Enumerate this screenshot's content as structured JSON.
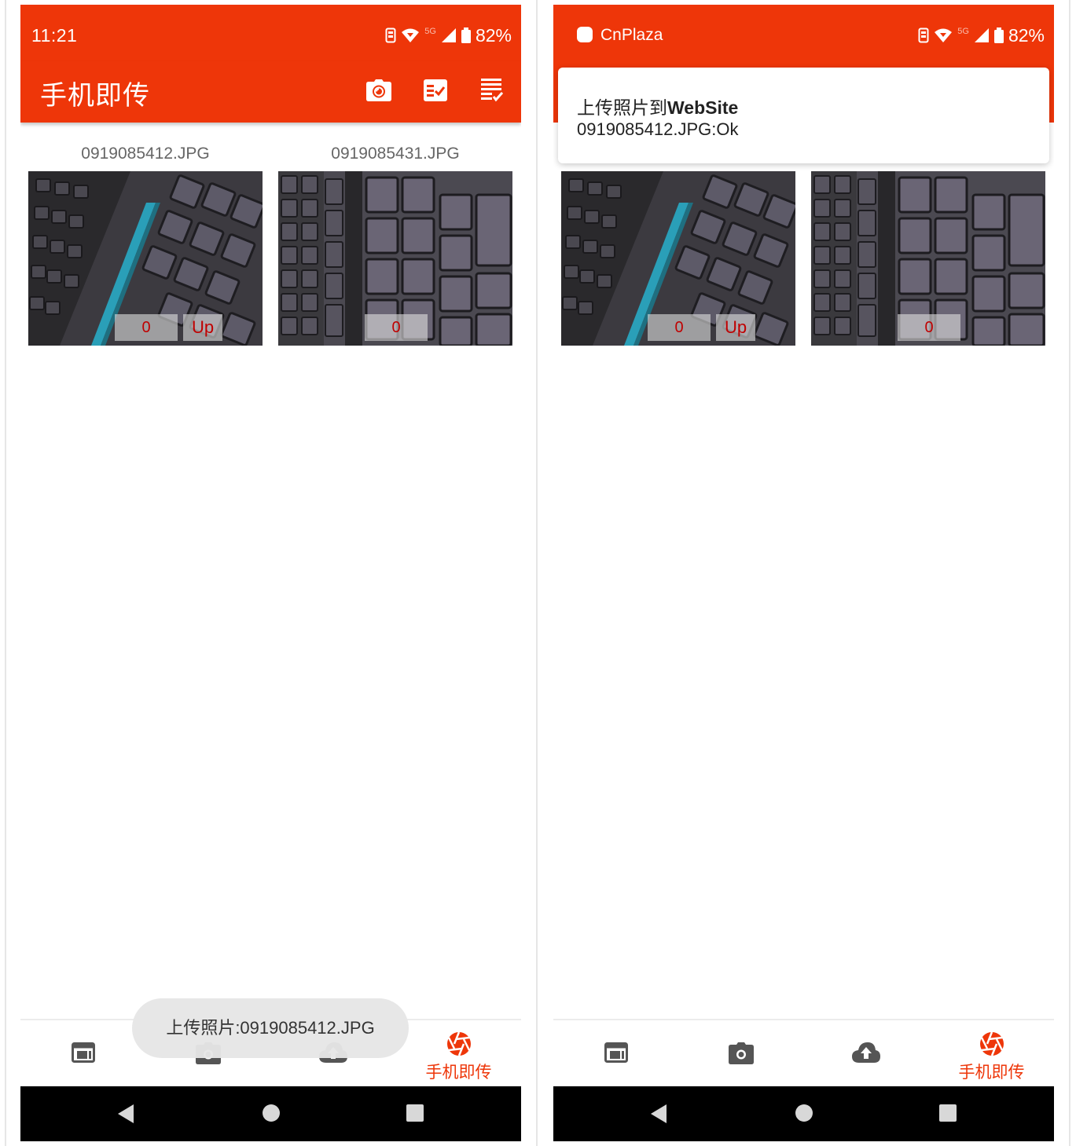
{
  "left_screen": {
    "status_bar": {
      "time": "11:21",
      "network": "5G",
      "battery": "82%"
    },
    "app_bar": {
      "title": "手机即传",
      "actions": [
        {
          "icon": "camera-icon"
        },
        {
          "icon": "checklist-icon"
        },
        {
          "icon": "list-check-icon"
        }
      ]
    },
    "photos": [
      {
        "file": "0919085412.JPG",
        "count": "0",
        "upload_label": "Up"
      },
      {
        "file": "0919085431.JPG",
        "count": "0"
      }
    ],
    "toast": "上传照片:0919085412.JPG"
  },
  "right_screen": {
    "status_bar": {
      "app_name": "CnPlaza",
      "network": "5G",
      "battery": "82%"
    },
    "notification": {
      "title_prefix": "上传照片到",
      "title_bold": "WebSite",
      "body": "0919085412.JPG:Ok"
    },
    "photos": [
      {
        "count": "0",
        "upload_label": "Up"
      },
      {
        "count": "0"
      }
    ]
  },
  "bottom_nav": {
    "items": [
      {
        "icon": "web-window-icon"
      },
      {
        "icon": "camera-icon"
      },
      {
        "icon": "cloud-upload-icon"
      },
      {
        "icon": "shutter-icon",
        "label": "手机即传",
        "active": true
      }
    ]
  },
  "system_nav": [
    "back",
    "home",
    "recents"
  ],
  "colors": {
    "accent": "#ee3609",
    "badge_text": "#c00000",
    "nav_icon": "#555555"
  }
}
